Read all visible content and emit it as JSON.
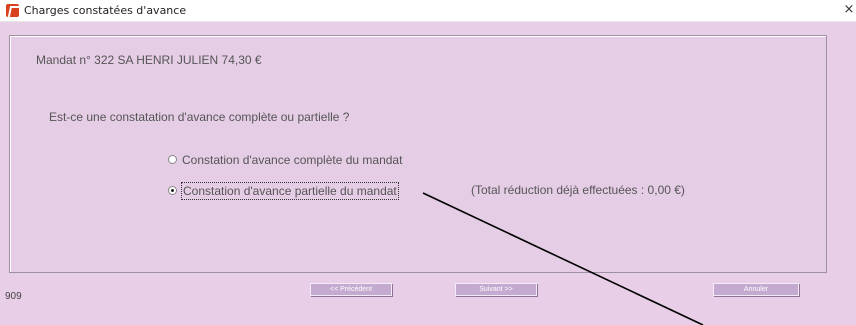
{
  "window": {
    "title": "Charges constatées d'avance",
    "close_glyph": "×",
    "icon": "app-logo-icon"
  },
  "content": {
    "mandat_line": "Mandat n° 322   SA HENRI JULIEN  74,30 €",
    "question": "Est-ce une constatation d'avance complète ou partielle ?",
    "options": [
      {
        "label": "Constation d'avance complète du mandat",
        "selected": false
      },
      {
        "label": "Constation d'avance partielle du mandat",
        "selected": true
      }
    ],
    "total_note": "(Total réduction déjà effectuées : 0,00 €)"
  },
  "buttons": {
    "previous": "<< Précédent",
    "next": "Suivant  >>",
    "cancel": "Annuler"
  },
  "status_code": "909",
  "colors": {
    "background": "#e8cfe7",
    "button": "#c4a9d0",
    "app_icon": "#d8421f"
  }
}
